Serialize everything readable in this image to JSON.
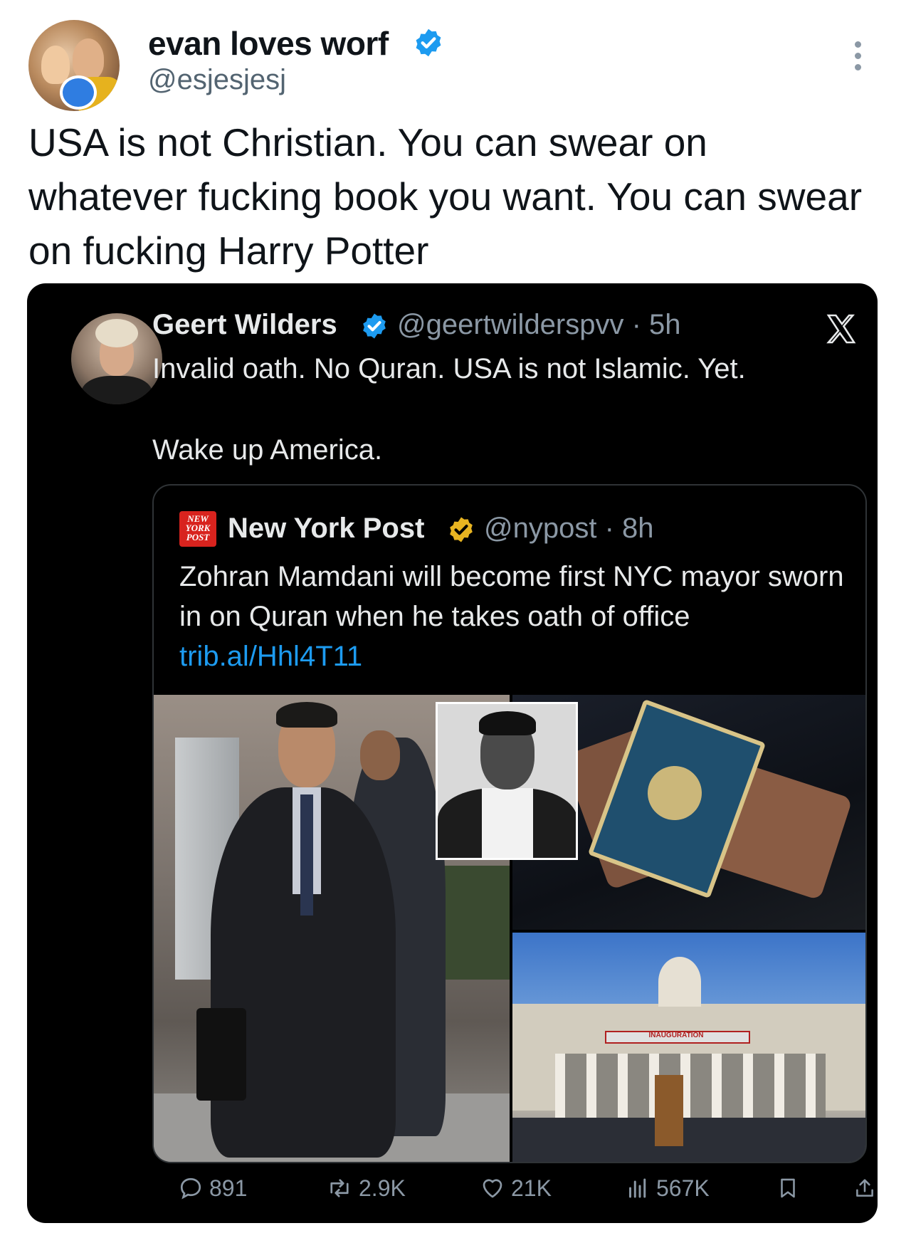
{
  "outer_tweet": {
    "display_name": "evan loves worf",
    "handle": "@esjesjesj",
    "text": "USA is not Christian. You can swear on whatever fucking book you want. You can swear on fucking Harry Potter",
    "verified_color": "#1d9bf0"
  },
  "embedded_tweet": {
    "display_name": "Geert Wilders",
    "meta": "@geertwilderspvv · 5h",
    "line1": "Invalid oath. No Quran. USA is not Islamic. Yet.",
    "line2": "Wake up America.",
    "verified_color": "#1d9bf0",
    "platform_logo": "x-logo"
  },
  "quoted_tweet": {
    "logo_text": "NEW YORK POST",
    "display_name": "New York Post",
    "meta": "@nypost · 8h",
    "text": "Zohran Mamdani will become first NYC mayor sworn in on Quran when he takes oath of office ",
    "link": "trib.al/Hhl4T11",
    "verified_color": "#e8b421",
    "banner_text": "INAUGURATION"
  },
  "actions": {
    "replies": "891",
    "reposts": "2.9K",
    "likes": "21K",
    "views": "567K"
  },
  "colors": {
    "link": "#1d9bf0",
    "card_bg": "#000000",
    "muted": "#8b98a5"
  }
}
